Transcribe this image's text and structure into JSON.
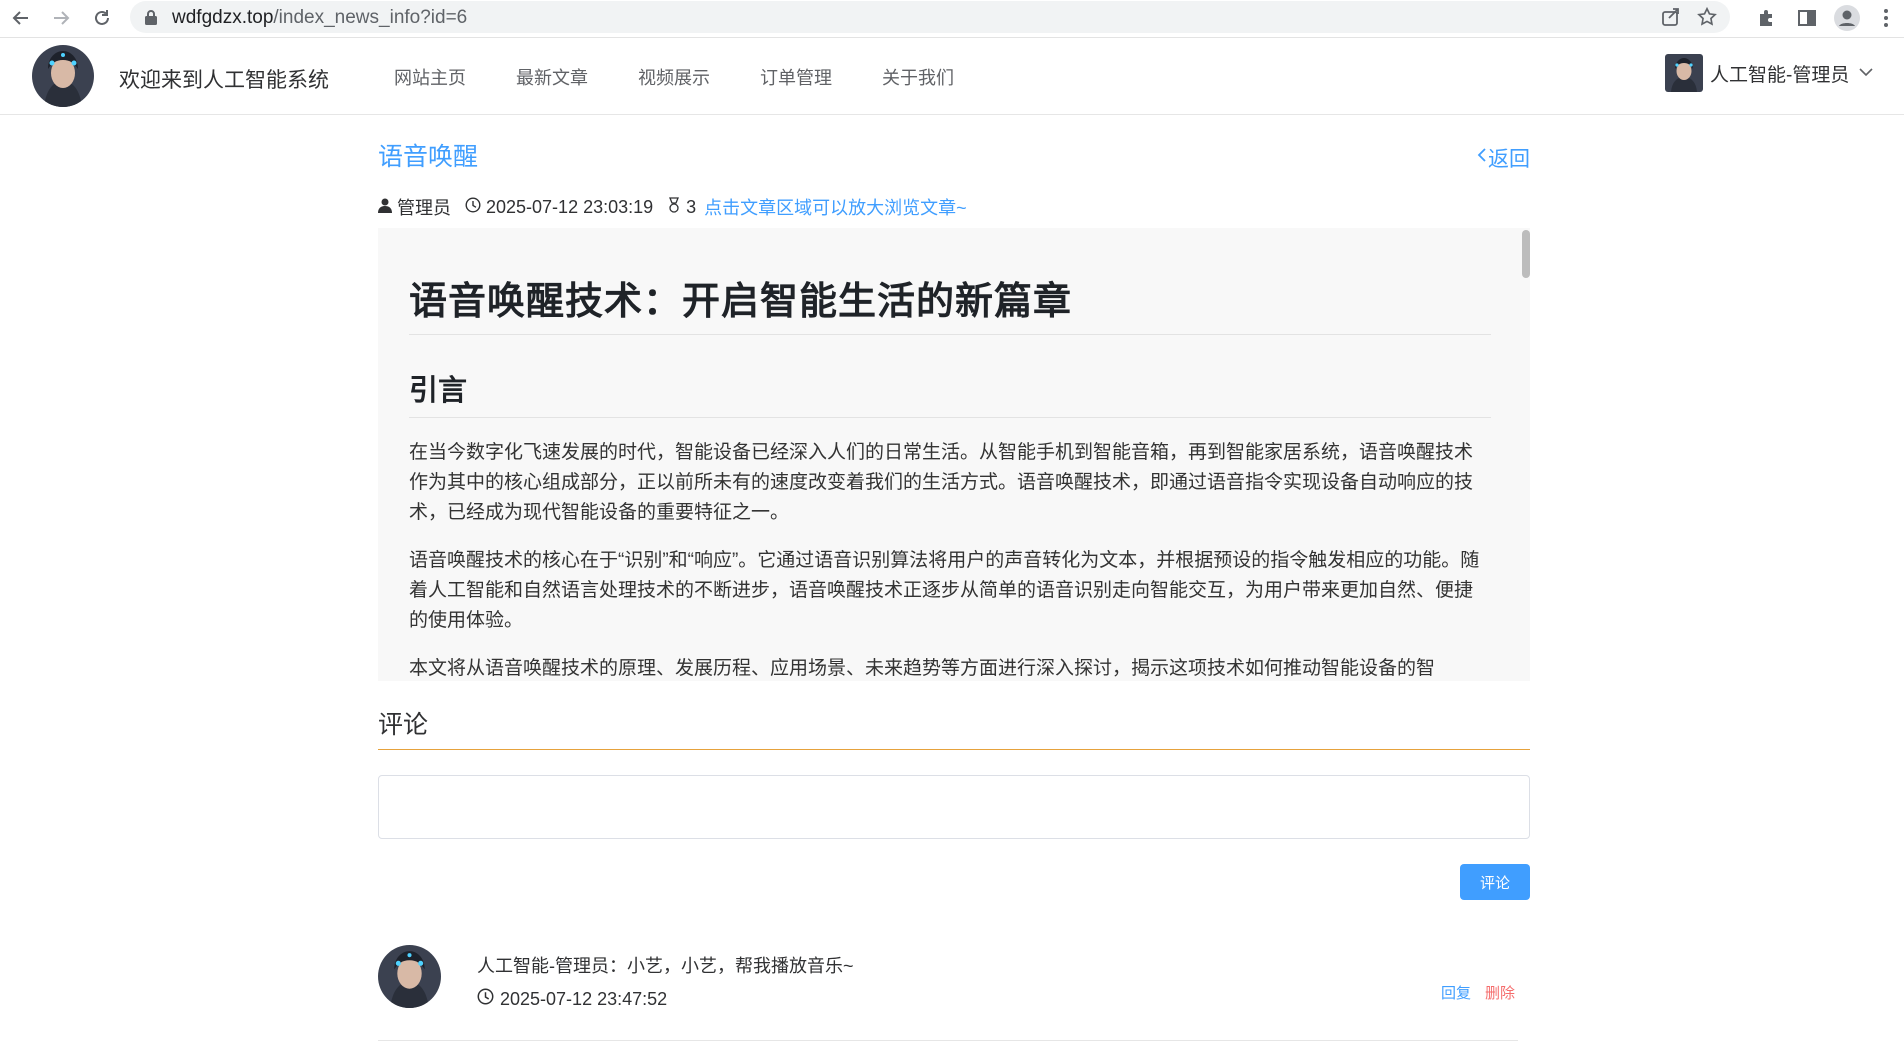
{
  "browser": {
    "url_host": "wdfgdzx.top",
    "url_path": "/index_news_info?id=6"
  },
  "header": {
    "site_title": "欢迎来到人工智能系统",
    "menu": [
      "网站主页",
      "最新文章",
      "视频展示",
      "订单管理",
      "关于我们"
    ],
    "user_name": "人工智能-管理员"
  },
  "article": {
    "title": "语音唤醒",
    "back_label": "返回",
    "author": "管理员",
    "datetime": "2025-07-12 23:03:19",
    "views": "3",
    "zoom_hint": "点击文章区域可以放大浏览文章~",
    "h1": "语音唤醒技术：开启智能生活的新篇章",
    "h2": "引言",
    "paragraphs": [
      "在当今数字化飞速发展的时代，智能设备已经深入人们的日常生活。从智能手机到智能音箱，再到智能家居系统，语音唤醒技术作为其中的核心组成部分，正以前所未有的速度改变着我们的生活方式。语音唤醒技术，即通过语音指令实现设备自动响应的技术，已经成为现代智能设备的重要特征之一。",
      "语音唤醒技术的核心在于“识别”和“响应”。它通过语音识别算法将用户的声音转化为文本，并根据预设的指令触发相应的功能。随着人工智能和自然语言处理技术的不断进步，语音唤醒技术正逐步从简单的语音识别走向智能交互，为用户带来更加自然、便捷的使用体验。",
      "本文将从语音唤醒技术的原理、发展历程、应用场景、未来趋势等方面进行深入探讨，揭示这项技术如何推动智能设备的智"
    ]
  },
  "comments": {
    "title": "评论",
    "input_placeholder": "",
    "submit_label": "评论",
    "items": [
      {
        "text": "人工智能-管理员：小艺，小艺，帮我播放音乐~",
        "time": "2025-07-12 23:47:52",
        "reply_label": "回复",
        "delete_label": "删除"
      }
    ]
  },
  "colors": {
    "accent": "#409eff",
    "danger": "#f56c6c",
    "divider_orange": "#e6a23c"
  },
  "icons": [
    "back-arrow-icon",
    "forward-arrow-icon",
    "reload-icon",
    "lock-icon",
    "share-icon",
    "star-icon",
    "extensions-icon",
    "side-panel-icon",
    "profile-icon",
    "kebab-menu-icon",
    "chevron-down-icon",
    "user-icon",
    "clock-icon",
    "views-icon",
    "chevron-left-icon"
  ]
}
